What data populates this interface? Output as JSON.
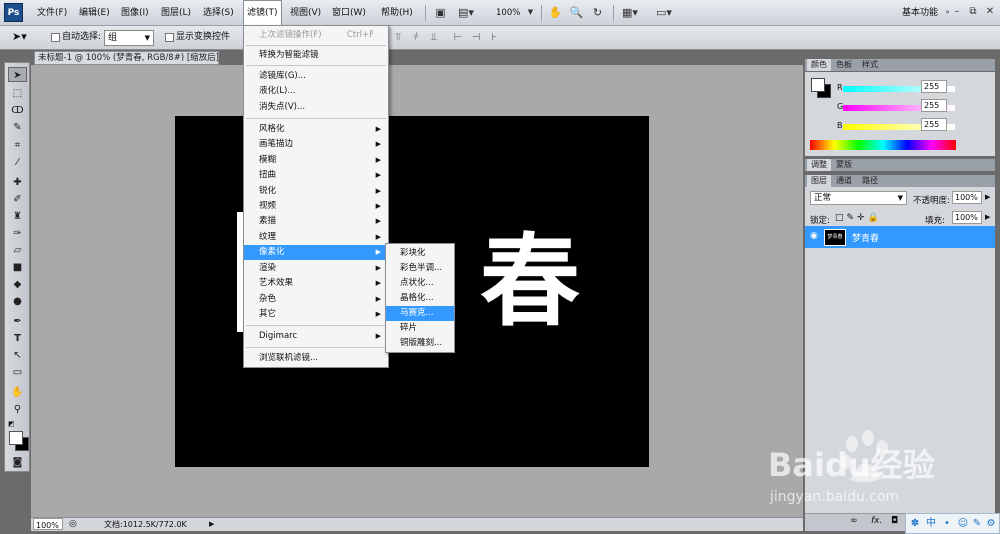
{
  "app": {
    "logo": "Ps",
    "workspace": "基本功能"
  },
  "menus": [
    "文件(F)",
    "编辑(E)",
    "图像(I)",
    "图层(L)",
    "选择(S)",
    "滤镜(T)",
    "视图(V)",
    "窗口(W)",
    "帮助(H)"
  ],
  "zoom_combo": "100%",
  "options_bar": {
    "auto_select_label": "自动选择:",
    "auto_select_value": "组",
    "show_transform_label": "显示变换控件"
  },
  "document": {
    "tab_title": "未标题-1 @ 100% (梦青春, RGB/8#) [缩放后] *",
    "canvas_text": "春"
  },
  "filter_menu": {
    "items": [
      {
        "label": "上次滤镜操作(F)",
        "shortcut": "Ctrl+F",
        "disabled": true
      },
      {
        "label": "转换为智能滤镜"
      },
      {
        "label": "滤镜库(G)..."
      },
      {
        "label": "液化(L)..."
      },
      {
        "label": "消失点(V)..."
      },
      {
        "label": "风格化",
        "submenu": true
      },
      {
        "label": "画笔描边",
        "submenu": true
      },
      {
        "label": "模糊",
        "submenu": true
      },
      {
        "label": "扭曲",
        "submenu": true
      },
      {
        "label": "锐化",
        "submenu": true
      },
      {
        "label": "视频",
        "submenu": true
      },
      {
        "label": "素描",
        "submenu": true
      },
      {
        "label": "纹理",
        "submenu": true
      },
      {
        "label": "像素化",
        "submenu": true,
        "highlighted": true
      },
      {
        "label": "渲染",
        "submenu": true
      },
      {
        "label": "艺术效果",
        "submenu": true
      },
      {
        "label": "杂色",
        "submenu": true
      },
      {
        "label": "其它",
        "submenu": true
      },
      {
        "label": "Digimarc",
        "submenu": true
      },
      {
        "label": "浏览联机滤镜..."
      }
    ]
  },
  "pixelate_submenu": [
    "彩块化",
    "彩色半调...",
    "点状化...",
    "晶格化...",
    "马赛克...",
    "碎片",
    "铜版雕刻..."
  ],
  "pixelate_highlighted": "马赛克...",
  "color_panel": {
    "tabs": [
      "颜色",
      "色板",
      "样式"
    ],
    "channels": [
      {
        "label": "R",
        "value": "255"
      },
      {
        "label": "G",
        "value": "255"
      },
      {
        "label": "B",
        "value": "255"
      }
    ]
  },
  "adjust_tabs": [
    "调整",
    "蒙版"
  ],
  "layers_panel": {
    "tabs": [
      "图层",
      "通道",
      "路径"
    ],
    "blend_mode": "正常",
    "opacity_label": "不透明度:",
    "opacity": "100%",
    "lock_label": "锁定:",
    "fill_label": "填充:",
    "fill": "100%",
    "layer_name": "梦青春",
    "layer_thumb_text": "梦青春"
  },
  "status": {
    "zoom": "100%",
    "doc_info": "文档:1012.5K/772.0K"
  },
  "watermark": {
    "word": "Baidu经验",
    "url": "jingyan.baidu.com"
  },
  "ime": [
    "中"
  ],
  "colors": {
    "highlight": "#3399ff",
    "canvas": "#000000"
  }
}
